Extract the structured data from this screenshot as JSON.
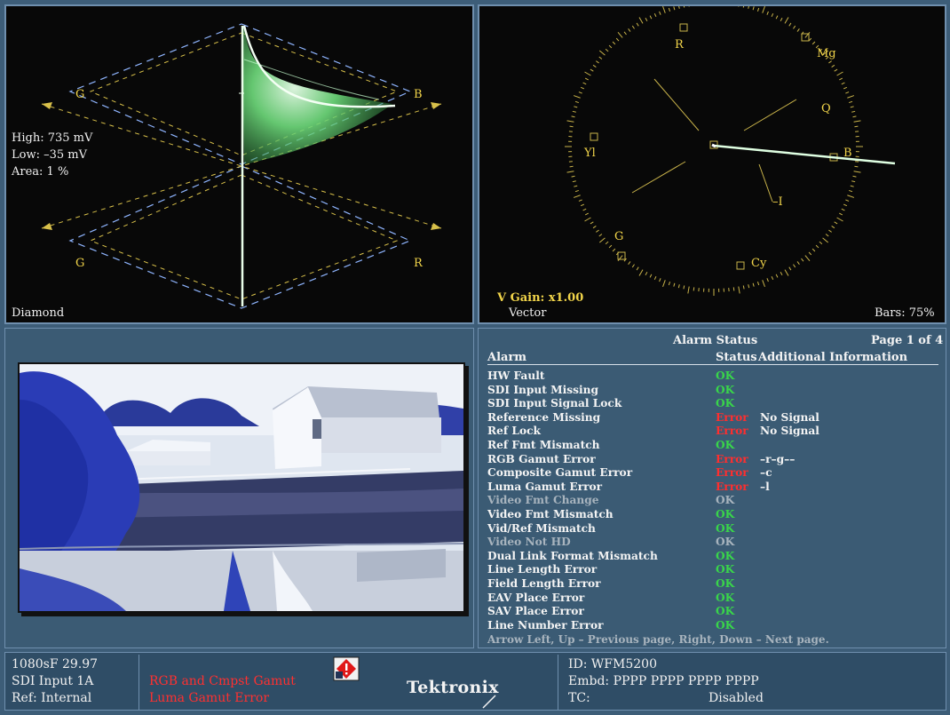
{
  "diamond": {
    "title": "Diamond",
    "high": "High: 735 mV",
    "low": "Low: –35 mV",
    "area": "Area:  1 %",
    "labels": {
      "g_top": "G",
      "b": "B",
      "g_bottom": "G",
      "r": "R"
    }
  },
  "vector": {
    "title": "Vector",
    "gain": "V Gain: x1.00",
    "bars": "Bars: 75%",
    "labels": {
      "r": "R",
      "mg": "Mg",
      "q": "Q",
      "yl": "Yl",
      "b": "B",
      "i": "–I",
      "g": "G",
      "cy": "Cy"
    }
  },
  "alarm": {
    "title": "Alarm Status",
    "page": "Page 1 of 4",
    "col_alarm": "Alarm",
    "col_status": "Status",
    "col_info": "Additional Information",
    "rows": [
      {
        "name": "HW Fault",
        "status": "OK",
        "info": ""
      },
      {
        "name": "SDI Input Missing",
        "status": "OK",
        "info": ""
      },
      {
        "name": "SDI Input Signal Lock",
        "status": "OK",
        "info": ""
      },
      {
        "name": "Reference Missing",
        "status": "Error",
        "info": "No Signal"
      },
      {
        "name": "Ref Lock",
        "status": "Error",
        "info": "No Signal"
      },
      {
        "name": "Ref Fmt Mismatch",
        "status": "OK",
        "info": ""
      },
      {
        "name": "RGB Gamut Error",
        "status": "Error",
        "info": "–r–g––"
      },
      {
        "name": "Composite Gamut Error",
        "status": "Error",
        "info": "–c"
      },
      {
        "name": "Luma Gamut Error",
        "status": "Error",
        "info": "–l"
      },
      {
        "name": "Video Fmt Change",
        "status": "OK",
        "info": "",
        "disabled": true
      },
      {
        "name": "Video Fmt Mismatch",
        "status": "OK",
        "info": ""
      },
      {
        "name": "Vid/Ref Mismatch",
        "status": "OK",
        "info": ""
      },
      {
        "name": "Video Not HD",
        "status": "OK",
        "info": "",
        "disabled": true
      },
      {
        "name": "Dual Link Format Mismatch",
        "status": "OK",
        "info": ""
      },
      {
        "name": "Line Length Error",
        "status": "OK",
        "info": ""
      },
      {
        "name": "Field Length Error",
        "status": "OK",
        "info": ""
      },
      {
        "name": "EAV Place Error",
        "status": "OK",
        "info": ""
      },
      {
        "name": "SAV Place Error",
        "status": "OK",
        "info": ""
      },
      {
        "name": "Line Number Error",
        "status": "OK",
        "info": ""
      }
    ],
    "help": "Arrow Left, Up – Previous page, Right, Down – Next page."
  },
  "status_bar": {
    "format": "1080sF 29.97",
    "input": "SDI Input 1A",
    "ref": "Ref: Internal",
    "alert_line1": "RGB and Cmpst Gamut",
    "alert_line2": "Luma Gamut Error",
    "logo": "Tektronix",
    "id": "ID: WFM5200",
    "embd": "Embd: PPPP PPPP PPPP PPPP",
    "tc_label": "TC:",
    "tc_value": "Disabled",
    "warning_icon": "warning-diamond-icon"
  },
  "colors": {
    "ok": "#39d64a",
    "error": "#ff2e2e",
    "graticule": "#f2d54a",
    "trace": "#8ff29a",
    "background": "#3d5d78"
  }
}
